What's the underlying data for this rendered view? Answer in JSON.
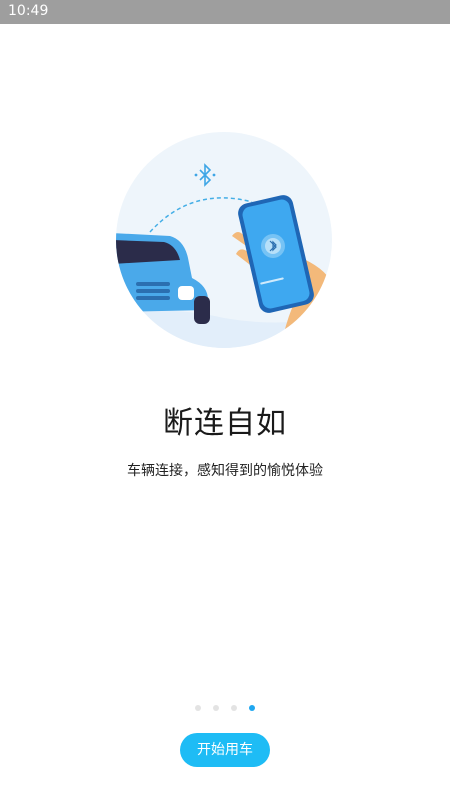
{
  "status_bar": {
    "time": "10:49"
  },
  "onboarding": {
    "title": "断连自如",
    "subtitle": "车辆连接，感知得到的愉悦体验",
    "page_count": 4,
    "current_page": 4
  },
  "actions": {
    "start_label": "开始用车"
  },
  "colors": {
    "accent": "#1ebcf5",
    "active_dot": "#1fa7f0",
    "inactive_dot": "#e3e3e3"
  },
  "illustration": {
    "icons": [
      "bluetooth-icon",
      "car",
      "phone",
      "hand"
    ]
  }
}
